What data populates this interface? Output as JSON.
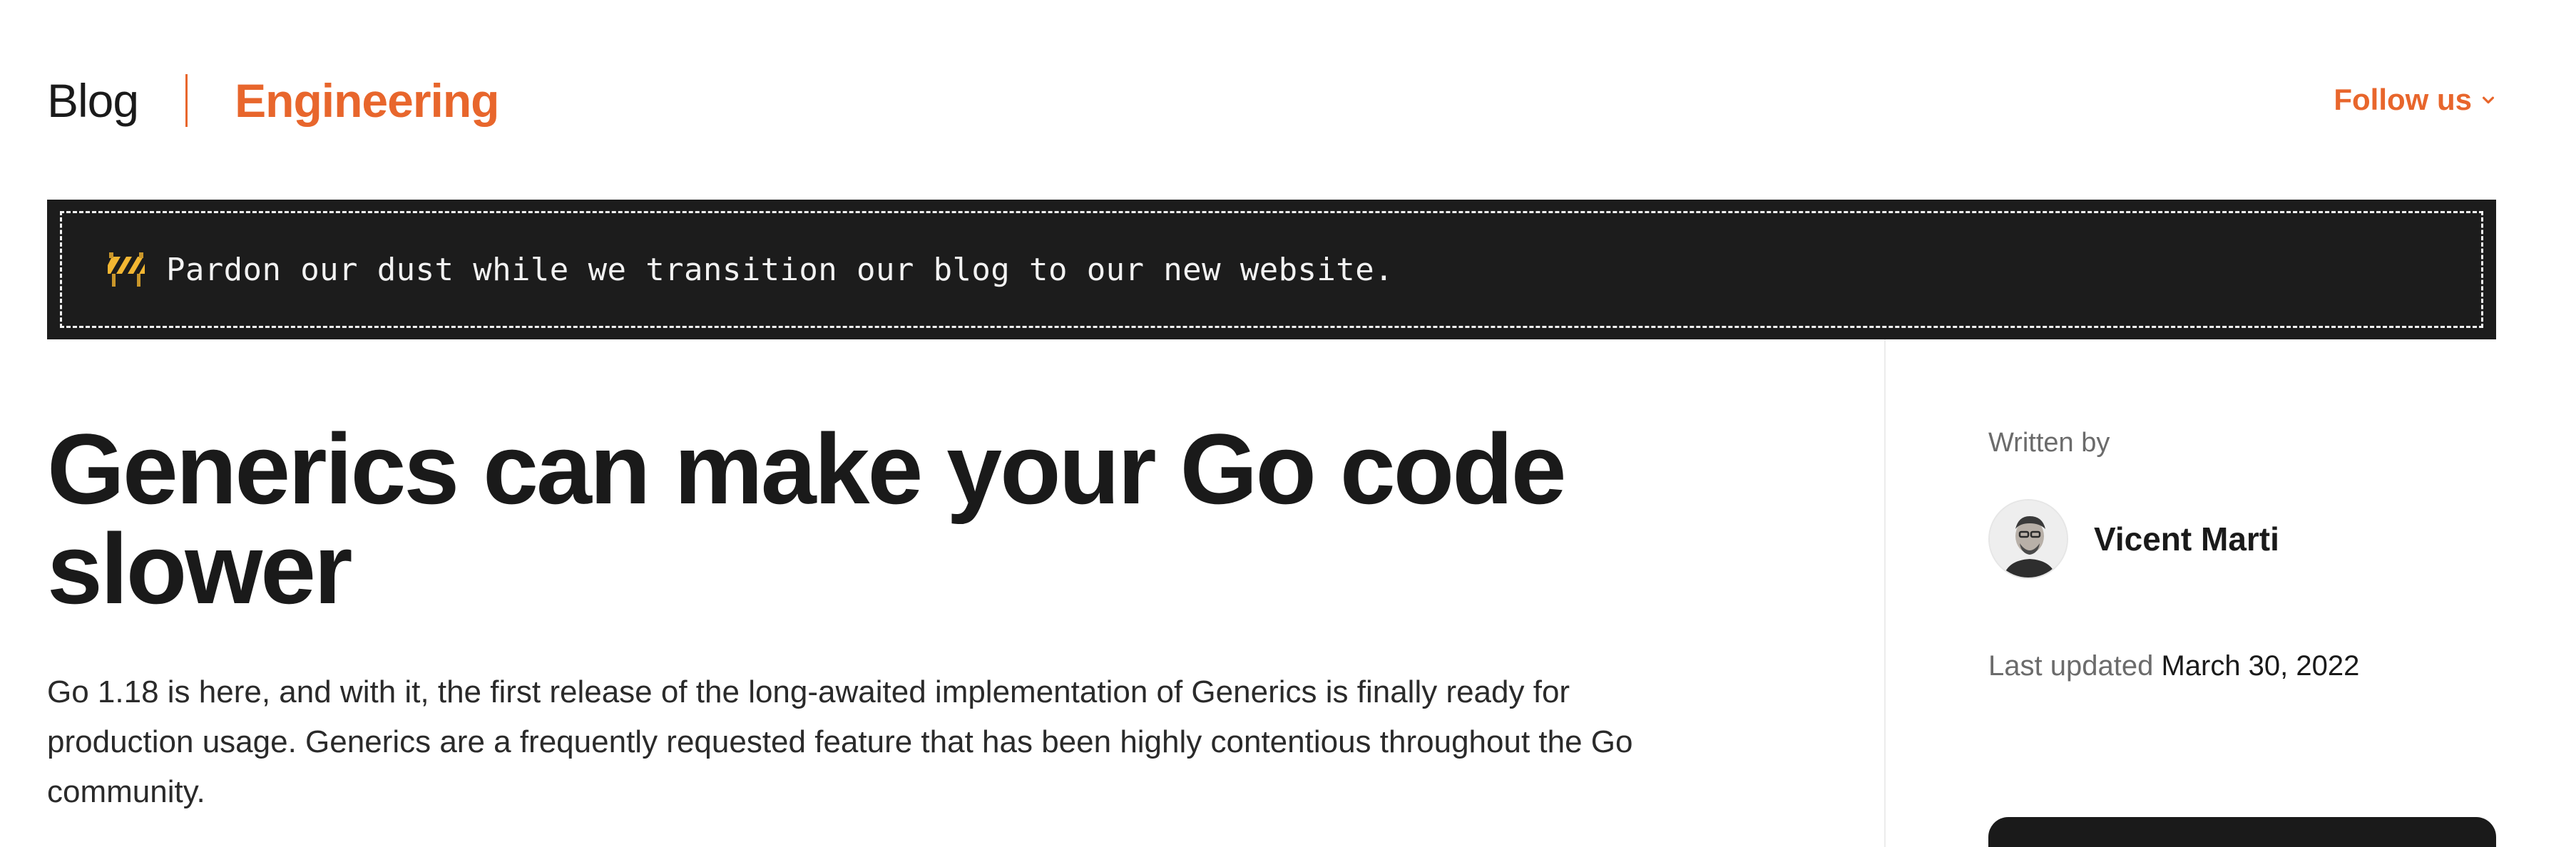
{
  "header": {
    "blog_label": "Blog",
    "engineering_label": "Engineering",
    "follow_label": "Follow us",
    "accent_color": "#e8662c"
  },
  "banner": {
    "icon": "construction-icon",
    "text": "Pardon our dust while we transition our blog to our new website."
  },
  "article": {
    "title": "Generics can make your Go code slower",
    "lede": "Go 1.18 is here, and with it, the first release of the long-awaited implementation of Generics is finally ready for production usage. Generics are a frequently requested feature that has been highly contentious throughout the Go community."
  },
  "sidebar": {
    "written_by_label": "Written by",
    "author_name": "Vicent Marti",
    "author_avatar": "avatar-photo",
    "last_updated_label": "Last updated",
    "last_updated_date": "March 30, 2022"
  }
}
